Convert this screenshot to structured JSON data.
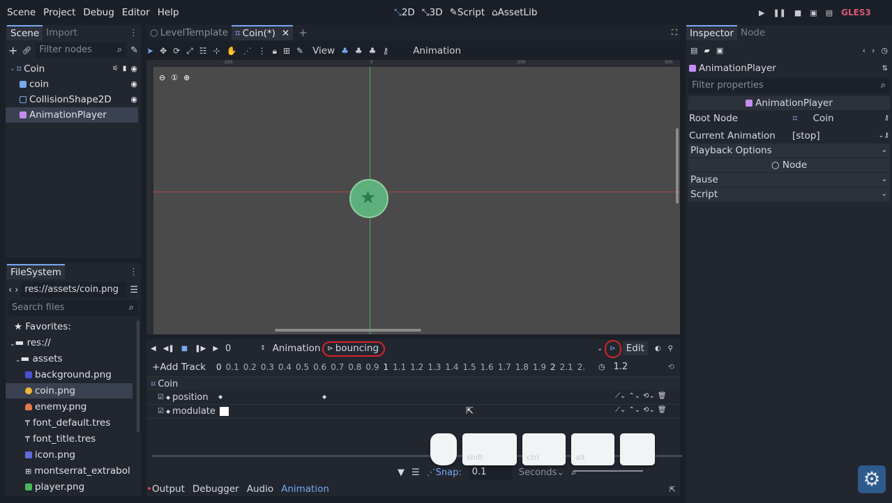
{
  "menu": [
    "Scene",
    "Project",
    "Debug",
    "Editor",
    "Help"
  ],
  "workspaces": [
    {
      "label": "2D",
      "icon": "2d-icon",
      "active": true
    },
    {
      "label": "3D",
      "icon": "3d-icon",
      "active": false
    },
    {
      "label": "Script",
      "icon": "script-icon",
      "active": false
    },
    {
      "label": "AssetLib",
      "icon": "assetlib-icon",
      "active": false
    }
  ],
  "renderer": "GLES3",
  "scene_dock": {
    "tabs": [
      "Scene",
      "Import"
    ],
    "filter_placeholder": "Filter nodes",
    "nodes": [
      {
        "label": "Coin",
        "depth": 0,
        "icon": "node2d-icon"
      },
      {
        "label": "coin",
        "depth": 1,
        "icon": "sprite-icon"
      },
      {
        "label": "CollisionShape2D",
        "depth": 1,
        "icon": "collisionshape-icon"
      },
      {
        "label": "AnimationPlayer",
        "depth": 1,
        "icon": "animationplayer-icon",
        "selected": true
      }
    ]
  },
  "filesystem": {
    "tab": "FileSystem",
    "path": "res://assets/coin.png",
    "search_placeholder": "Search files",
    "favorites": "Favorites:",
    "root": "res://",
    "folder": "assets",
    "files": [
      "background.png",
      "coin.png",
      "enemy.png",
      "font_default.tres",
      "font_title.tres",
      "icon.png",
      "montserrat_extrabol",
      "player.png"
    ],
    "selected_file": "coin.png"
  },
  "editor_tabs": [
    "LevelTemplate",
    "Coin(*)"
  ],
  "toolbar2d": {
    "view_label": "View",
    "animation_label": "Animation"
  },
  "ruler_ticks": [
    "-250",
    "0",
    "250",
    "500"
  ],
  "anim": {
    "frame_value": "0",
    "animation_label": "Animation",
    "current_animation": "bouncing",
    "edit_label": "Edit",
    "add_track": "Add Track",
    "timeline": [
      "0",
      "0.1",
      "0.2",
      "0.3",
      "0.4",
      "0.5",
      "0.6",
      "0.7",
      "0.8",
      "0.9",
      "1",
      "1.1",
      "1.2",
      "1.3",
      "1.4",
      "1.5",
      "1.6",
      "1.7",
      "1.8",
      "1.9",
      "2",
      "2.1",
      "2."
    ],
    "length": "1.2",
    "root_track": "Coin",
    "tracks": [
      "position",
      "modulate"
    ],
    "snap_label": "Snap:",
    "snap_value": "0.1",
    "snap_unit": "Seconds"
  },
  "bottom_tabs": [
    {
      "label": "Output",
      "active": false
    },
    {
      "label": "Debugger",
      "active": false
    },
    {
      "label": "Audio",
      "active": false
    },
    {
      "label": "Animation",
      "active": true
    }
  ],
  "key_overlay": [
    "",
    "shift",
    "ctrl",
    "alt",
    ""
  ],
  "inspector": {
    "tabs": [
      "Inspector",
      "Node"
    ],
    "object_name": "AnimationPlayer",
    "filter_placeholder": "Filter properties",
    "section_title": "AnimationPlayer",
    "root_node_label": "Root Node",
    "root_node_value": "Coin",
    "current_anim_label": "Current Animation",
    "current_anim_value": "[stop]",
    "playback_options": "Playback Options",
    "node_section": "Node",
    "pause": "Pause",
    "script": "Script"
  },
  "colors": {
    "accent": "#7aa8f0",
    "highlight_ring": "#d8232a",
    "coin_fill": "#4caf7d"
  }
}
